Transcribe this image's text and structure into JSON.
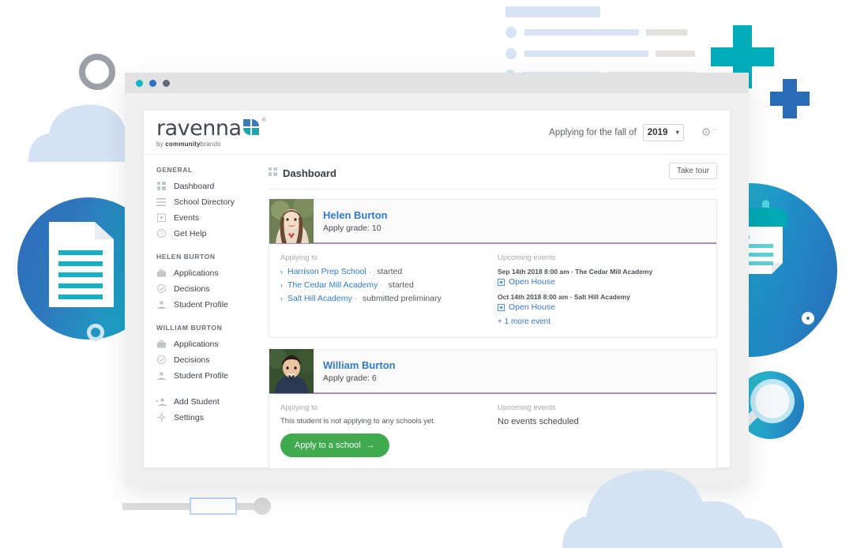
{
  "window": {
    "dots": [
      "teal",
      "blue",
      "gray"
    ]
  },
  "header": {
    "logo_word": "ravenna",
    "logo_registered": "®",
    "logo_sub_prefix": "by ",
    "logo_sub_bold": "community",
    "logo_sub_rest": "brands",
    "fall_label": "Applying for the fall of",
    "year_value": "2019",
    "year_caret": "▾",
    "gear_icon": "gear-icon",
    "gear_caret": "ˇ"
  },
  "sidebar": {
    "groups": [
      {
        "title": "GENERAL",
        "items": [
          {
            "label": "Dashboard",
            "icon": "dashboard-grid-icon"
          },
          {
            "label": "School Directory",
            "icon": "list-icon"
          },
          {
            "label": "Events",
            "icon": "calendar-icon"
          },
          {
            "label": "Get Help",
            "icon": "question-circle-icon"
          }
        ]
      },
      {
        "title": "HELEN BURTON",
        "items": [
          {
            "label": "Applications",
            "icon": "briefcase-icon"
          },
          {
            "label": "Decisions",
            "icon": "check-circle-icon"
          },
          {
            "label": "Student Profile",
            "icon": "person-icon"
          }
        ]
      },
      {
        "title": "WILLIAM BURTON",
        "items": [
          {
            "label": "Applications",
            "icon": "briefcase-icon"
          },
          {
            "label": "Decisions",
            "icon": "check-circle-icon"
          },
          {
            "label": "Student Profile",
            "icon": "person-icon"
          }
        ]
      },
      {
        "title": "",
        "items": [
          {
            "label": "Add Student",
            "icon": "add-person-icon"
          },
          {
            "label": "Settings",
            "icon": "gear-icon"
          }
        ]
      }
    ]
  },
  "main": {
    "page_title": "Dashboard",
    "page_title_icon": "dashboard-grid-icon",
    "take_tour_label": "Take tour",
    "column_titles": {
      "applying": "Applying to",
      "events": "Upcoming events"
    },
    "students": [
      {
        "name": "Helen Burton",
        "grade_label": "Apply grade: 10",
        "avatar": "helen-photo",
        "applications": [
          {
            "school": "Harrison Prep School",
            "status": "started"
          },
          {
            "school": "The Cedar Mill Academy",
            "status": "started"
          },
          {
            "school": "Salt Hill Academy",
            "status": "submitted preliminary"
          }
        ],
        "events": [
          {
            "meta": "Sep 14th 2018 8:00 am · The Cedar Mill Academy",
            "name": "Open House"
          },
          {
            "meta": "Oct 14th 2018 8:00 am · Salt Hill Academy",
            "name": "Open House"
          }
        ],
        "more_events": "+ 1 more event",
        "empty_applications": "",
        "empty_events": "",
        "apply_button": ""
      },
      {
        "name": "William Burton",
        "grade_label": "Apply grade: 6",
        "avatar": "william-photo",
        "applications": [],
        "events": [],
        "more_events": "",
        "empty_applications": "This student is not applying to any schools yet.",
        "empty_events": "No events scheduled",
        "apply_button": "Apply to a school"
      }
    ]
  },
  "decorations": {
    "shapes": [
      "gray-ring",
      "light-blue-cloud-left",
      "blue-teal-gradient-circle-document",
      "teal-blue-gradient-circle-calendar",
      "white-ring",
      "teal-blue-gradient-circle-magnifier",
      "teal-plus",
      "blue-plus",
      "skeleton-list",
      "slider-bar",
      "light-blue-cloud-bottom"
    ],
    "colors": {
      "teal": "#00adb9",
      "blue": "#2b6cb8",
      "cloud": "#d3e3f3",
      "gray_ring": "#9aa0a6",
      "green_button": "#3faa4e",
      "link_blue": "#2f7bd1",
      "card_accent_purple": "#a98ac4"
    }
  }
}
